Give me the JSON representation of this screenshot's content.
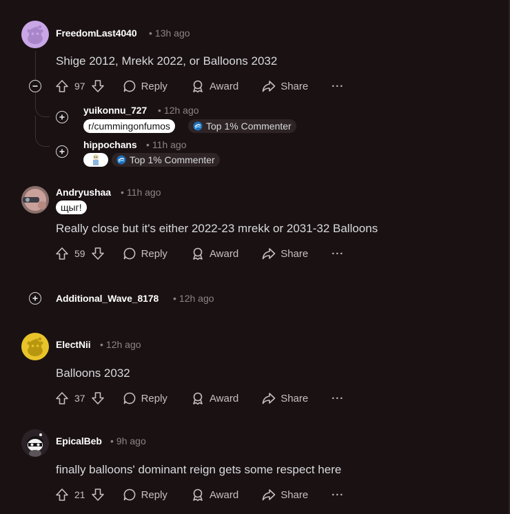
{
  "comments": [
    {
      "username": "FreedomLast4040",
      "time": "13h ago",
      "body": "Shige 2012, Mrekk 2022, or Balloons 2032",
      "votes": "97",
      "reply_label": "Reply",
      "award_label": "Award",
      "share_label": "Share",
      "more_label": "···",
      "avatar_color": "#c9a6e6",
      "replies": [
        {
          "username": "yuikonnu_727",
          "time": "12h ago",
          "flair": "r/cummingonfumos",
          "badge": "Top 1% Commenter"
        },
        {
          "username": "hippochans",
          "time": "11h ago",
          "badge": "Top 1% Commenter"
        }
      ]
    },
    {
      "username": "Andryushaa",
      "time": "11h ago",
      "flair": "щыг!",
      "body": "Really close but it's either 2022-23 mrekk or 2031-32 Balloons",
      "votes": "59",
      "reply_label": "Reply",
      "award_label": "Award",
      "share_label": "Share",
      "more_label": "···"
    },
    {
      "username": "Additional_Wave_8178",
      "time": "12h ago"
    },
    {
      "username": "ElectNii",
      "time": "12h ago",
      "body": "Balloons 2032",
      "votes": "37",
      "reply_label": "Reply",
      "award_label": "Award",
      "share_label": "Share",
      "more_label": "···",
      "avatar_color": "#e8c42a"
    },
    {
      "username": "EpicalBeb",
      "time": "9h ago",
      "body": "finally balloons' dominant reign gets some respect here",
      "votes": "21",
      "reply_label": "Reply",
      "award_label": "Award",
      "share_label": "Share",
      "more_label": "···"
    }
  ],
  "meta_separator": "•",
  "colors": {
    "background": "#1a1113",
    "username": "#ffffff",
    "meta": "#8e8488",
    "body": "#d7dadc",
    "thread_line": "#3d3336"
  }
}
